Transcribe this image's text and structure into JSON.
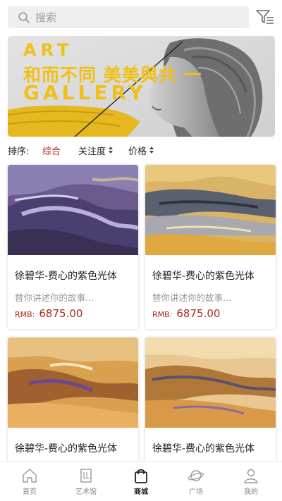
{
  "search": {
    "placeholder": "搜索"
  },
  "banner": {
    "line1": "ART",
    "line2": "和而不同 美美與共 一",
    "line3": "GALLERY"
  },
  "sort": {
    "label": "排序:",
    "options": [
      {
        "label": "综合",
        "active": true
      },
      {
        "label": "关注度",
        "active": false
      },
      {
        "label": "价格",
        "active": false
      }
    ]
  },
  "products": [
    {
      "title": "徐碧华-费心的紫色光体",
      "desc": "替你讲述你的故事...",
      "currency": "RMB:",
      "price": "6875.00"
    },
    {
      "title": "徐碧华-费心的紫色光体",
      "desc": "替你讲述你的故事...",
      "currency": "RMB:",
      "price": "6875.00"
    },
    {
      "title": "徐碧华-费心的紫色光体",
      "desc": "",
      "currency": "",
      "price": ""
    },
    {
      "title": "徐碧华-费心的紫色光体",
      "desc": "",
      "currency": "",
      "price": ""
    }
  ],
  "tabs": [
    {
      "label": "首页",
      "icon": "home-icon"
    },
    {
      "label": "艺术馆",
      "icon": "gallery-icon"
    },
    {
      "label": "商城",
      "icon": "shopping-bag-icon",
      "active": true
    },
    {
      "label": "广场",
      "icon": "planet-icon"
    },
    {
      "label": "我的",
      "icon": "user-icon"
    }
  ],
  "colors": {
    "accent": "#b0281e",
    "banner_yellow": "#f0c018"
  }
}
